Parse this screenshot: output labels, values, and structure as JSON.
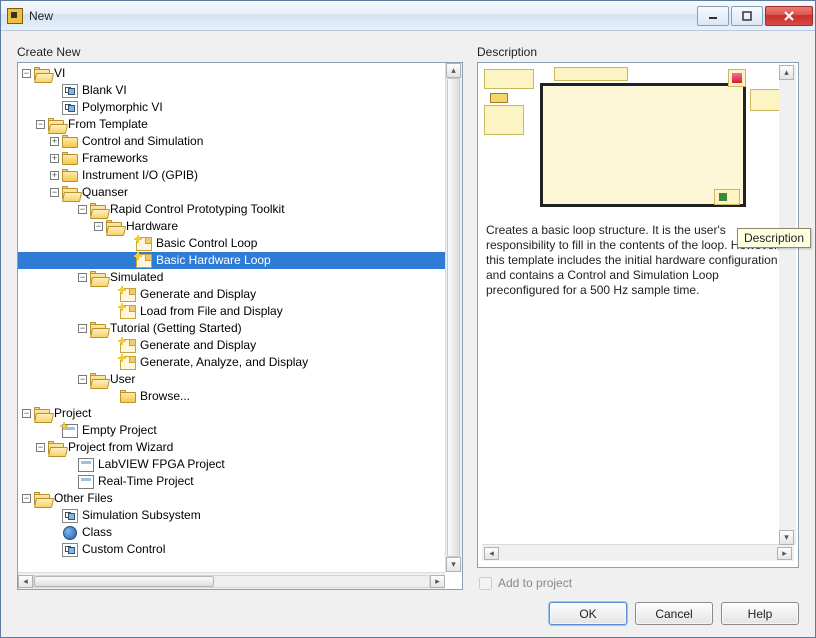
{
  "window": {
    "title": "New"
  },
  "left": {
    "heading": "Create New"
  },
  "right": {
    "heading": "Description",
    "text": "Creates a basic loop structure. It is the user's responsibility to fill in the contents of the loop. However, this template includes the initial hardware configuration and contains a Control and Simulation Loop preconfigured for a 500 Hz sample time.",
    "tooltip": "Description",
    "add_label": "Add to project"
  },
  "buttons": {
    "ok": "OK",
    "cancel": "Cancel",
    "help": "Help"
  },
  "tree": {
    "vi": "VI",
    "blank_vi": "Blank VI",
    "polymorphic_vi": "Polymorphic VI",
    "from_template": "From Template",
    "control_sim": "Control and Simulation",
    "frameworks": "Frameworks",
    "instr_io": "Instrument I/O (GPIB)",
    "quanser": "Quanser",
    "rcpt": "Rapid Control Prototyping Toolkit",
    "hardware": "Hardware",
    "basic_control_loop": "Basic Control Loop",
    "basic_hardware_loop": "Basic Hardware Loop",
    "simulated": "Simulated",
    "gen_display": "Generate and Display",
    "load_display": "Load from File and Display",
    "tutorial": "Tutorial (Getting Started)",
    "gen_display2": "Generate and Display",
    "gen_analyze": "Generate, Analyze, and Display",
    "user": "User",
    "browse": "Browse...",
    "project": "Project",
    "empty_project": "Empty Project",
    "proj_wizard": "Project from Wizard",
    "fpga_proj": "LabVIEW FPGA Project",
    "rt_proj": "Real-Time Project",
    "other_files": "Other Files",
    "sim_subsys": "Simulation Subsystem",
    "class": "Class",
    "custom_control": "Custom Control"
  }
}
